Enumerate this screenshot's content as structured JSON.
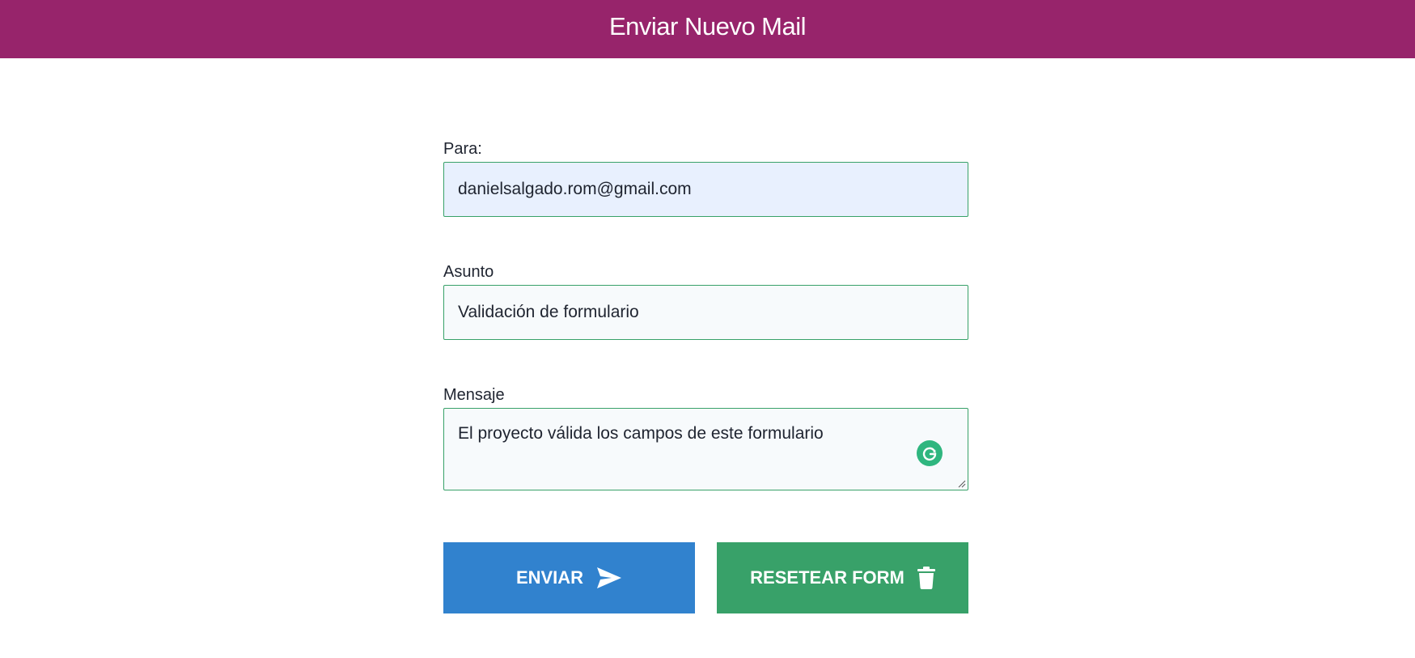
{
  "header": {
    "title": "Enviar Nuevo Mail",
    "background": "#97246b"
  },
  "form": {
    "to": {
      "label": "Para:",
      "value": "danielsalgado.rom@gmail.com"
    },
    "subject": {
      "label": "Asunto",
      "value": "Validación de formulario"
    },
    "message": {
      "label": "Mensaje",
      "value": "El proyecto válida los campos de este formulario"
    },
    "accent_border": "#38a169"
  },
  "actions": {
    "send": {
      "label": "ENVIAR",
      "icon": "paper-plane-icon",
      "color": "#3182ce"
    },
    "reset": {
      "label": "RESETEAR FORM",
      "icon": "trash-icon",
      "color": "#38a169"
    }
  },
  "extensions": {
    "grammarly_icon": "grammarly-icon"
  }
}
